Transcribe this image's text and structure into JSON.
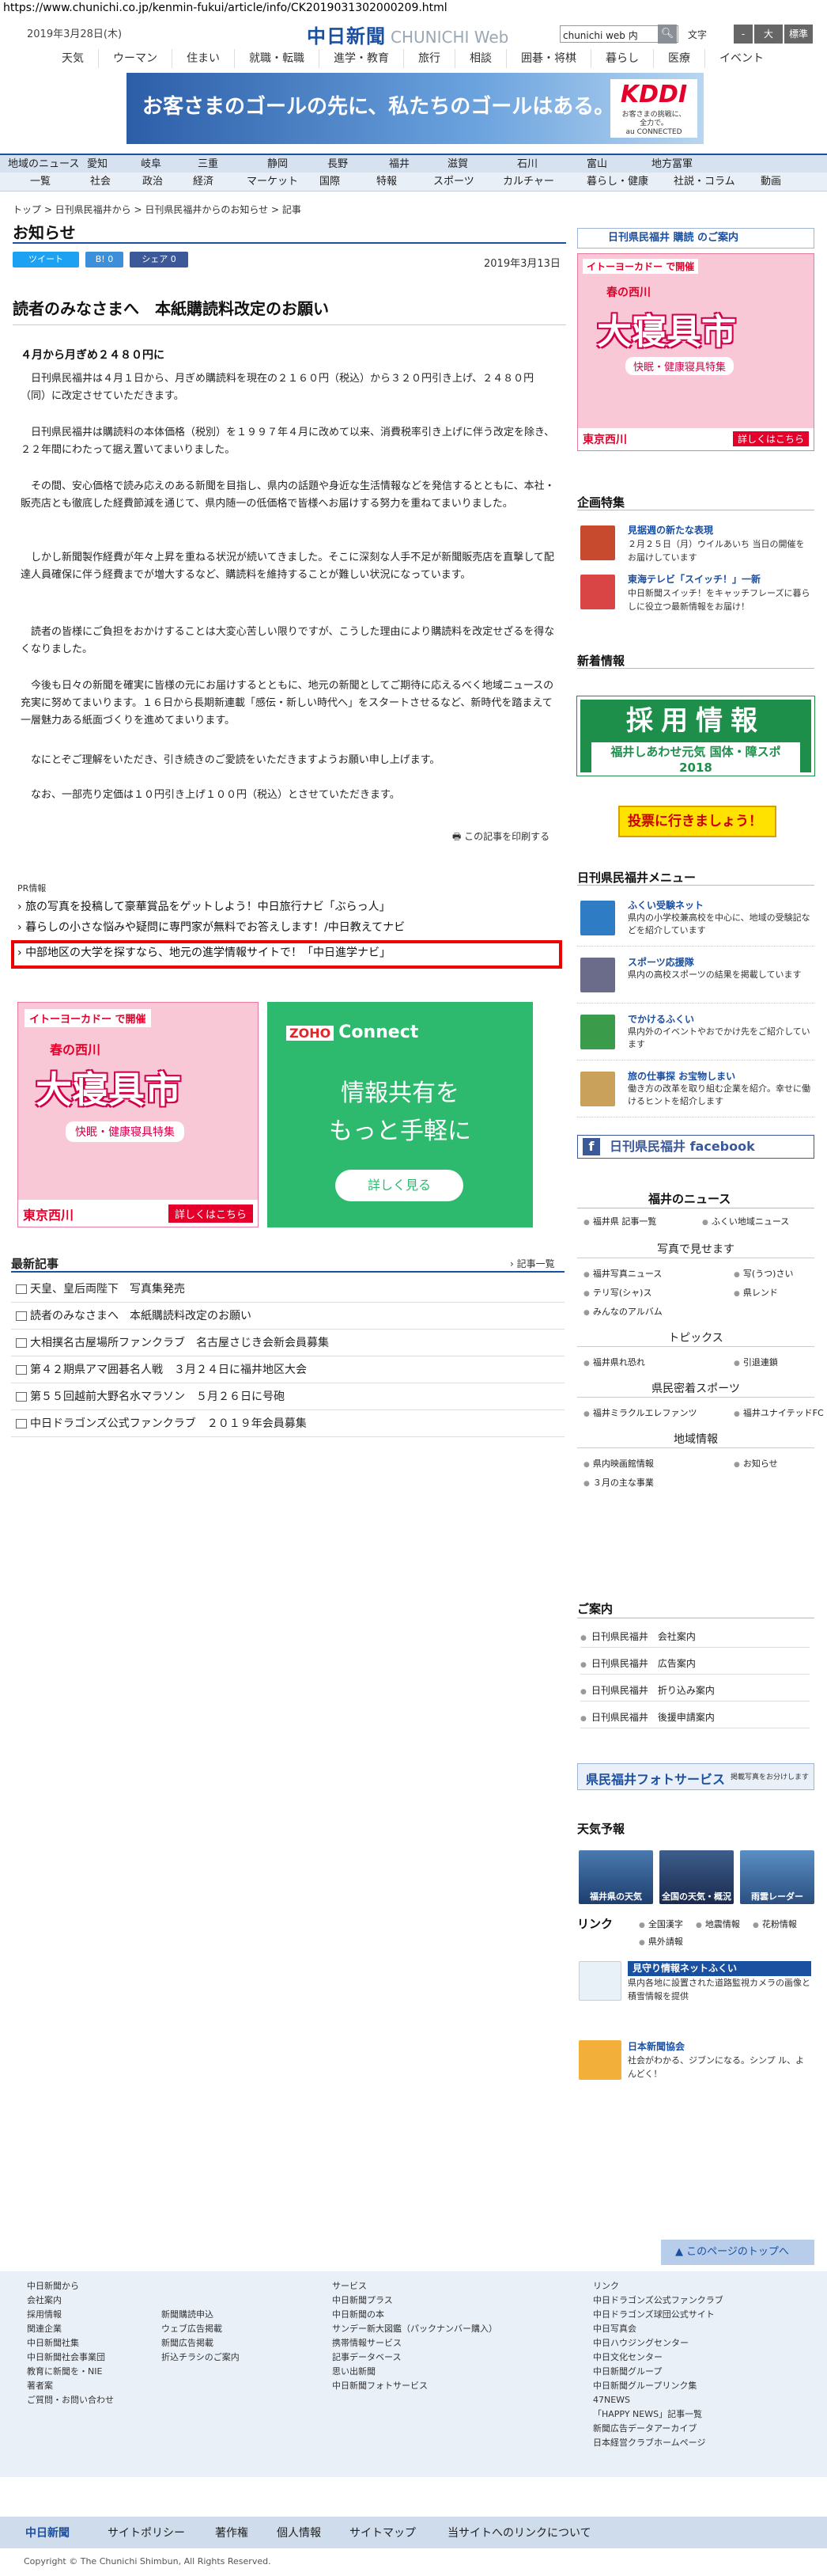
{
  "browser": {
    "url": "https://www.chunichi.co.jp/kenmin-fukui/article/info/CK2019031302000209.html"
  },
  "header": {
    "date": "2019年3月28日(木)",
    "logo_jp": "中日新聞",
    "logo_en": "CHUNICHI Web",
    "search_value": "chunichi web 内",
    "font_size_label": "文字",
    "font_minus": "-",
    "font_plus": "+",
    "font_large": "大",
    "font_normal": "標準",
    "nav": [
      "天気",
      "ウーマン",
      "住まい",
      "就職・転職",
      "進学・教育",
      "旅行",
      "相談",
      "囲碁・将棋",
      "暮らし",
      "医療",
      "イベント"
    ]
  },
  "banner": {
    "text": "お客さまのゴールの先に、私たちのゴールはある。",
    "brand": "KDDI",
    "brand_sub1": "お客さまの挑戦に、",
    "brand_sub2": "全力で。",
    "brand_sub3": "au CONNECTED"
  },
  "region_nav": [
    "地域のニュース",
    "愛知",
    "岐阜",
    "三重",
    "静岡",
    "長野",
    "福井",
    "滋賀",
    "石川",
    "富山",
    "地方冨軍"
  ],
  "category_nav": [
    "一覧",
    "社会",
    "政治",
    "経済",
    "マーケット",
    "国際",
    "特報",
    "スポーツ",
    "カルチャー",
    "暮らし・健康",
    "社説・コラム",
    "動画"
  ],
  "breadcrumb": "トップ > 日刊県民福井から > 日刊県民福井からのお知らせ > 記事",
  "page_title": "お知らせ",
  "share": {
    "tweet": "ツイート",
    "b": "B!",
    "b_count": "0",
    "share": "シェア",
    "share_count": "0"
  },
  "article": {
    "date": "2019年3月13日",
    "headline": "読者のみなさまへ　本紙購読料改定のお願い",
    "lead": "４月から月ぎめ２４８０円に",
    "paragraphs": [
      "　日刊県民福井は４月１日から、月ぎめ購読料を現在の２１６０円（税込）から３２０円引き上げ、２４８０円（同）に改定させていただきます。",
      "　日刊県民福井は購読料の本体価格（税別）を１９９７年４月に改めて以来、消費税率引き上げに伴う改定を除き、２２年間にわたって据え置いてまいりました。",
      "　その間、安心価格で読み応えのある新聞を目指し、県内の話題や身近な生活情報などを発信するとともに、本社・販売店とも徹底した経費節減を通じて、県内随一の低価格で皆様へお届けする努力を重ねてまいりました。",
      "　しかし新聞製作経費が年々上昇を重ねる状況が続いてきました。そこに深刻な人手不足が新聞販売店を直撃して配達人員確保に伴う経費までが増大するなど、購読料を維持することが難しい状況になっています。",
      "　読者の皆様にご負担をおかけすることは大変心苦しい限りですが、こうした理由により購読料を改定せざるを得なくなりました。",
      "　今後も日々の新聞を確実に皆様の元にお届けするとともに、地元の新聞としてご期待に応えるべく地域ニュースの充実に努めてまいります。１６日から長期新連載「感伝・新しい時代へ」をスタートさせるなど、新時代を踏まえて一層魅力ある紙面づくりを進めてまいります。",
      "　なにとぞご理解をいただき、引き続きのご愛読をいただきますようお願い申し上げます。",
      "　なお、一部売り定価は１０円引き上げ１００円（税込）とさせていただきます。"
    ],
    "print": "この記事を印刷する"
  },
  "pr": {
    "label": "PR情報",
    "items": [
      "旅の写真を投稿して豪華賞品をゲットしよう！中日旅行ナビ「ぶらっ人」",
      "暮らしの小さな悩みや疑問に専門家が無料でお答えします！/中日教えてナビ",
      "中部地区の大学を探すなら、地元の進学情報サイトで！「中日進学ナビ」"
    ]
  },
  "ad_ito": {
    "brand": "イトーヨーカドー で開催",
    "mid": "春の西川",
    "big": "大寝具市",
    "sub": "快眠・健康寝具特集",
    "store": "東京西川",
    "more": "詳しくはこちら"
  },
  "ad_zoho": {
    "brand": "ZOHO",
    "name": "Connect",
    "line1": "情報共有を",
    "line2": "もっと手軽に",
    "cta": "詳しく見る"
  },
  "latest": {
    "heading": "最新記事",
    "all": "記事一覧",
    "items": [
      "天皇、皇后両陛下　写真集発売",
      "読者のみなさまへ　本紙購読料改定のお願い",
      "大相撲名古屋場所ファンクラブ　名古屋さじき会新会員募集",
      "第４２期県アマ囲碁名人戦　３月２４日に福井地区大会",
      "第５５回越前大野名水マラソン　５月２６日に号砲",
      "中日ドラゴンズ公式ファンクラブ　２０１９年会員募集"
    ]
  },
  "right": {
    "kounyu": "日刊県民福井 購読 のご案内",
    "kikaku_heading": "企画特集",
    "kikaku": [
      {
        "title": "見据週の新たな表現",
        "desc": "２月２５日（月）ウイルあいち 当日の開催をお届けしています"
      },
      {
        "title": "東海テレビ「スイッチ！」一新",
        "desc": "中日新聞スイッチ！をキャッチフレーズに暮らしに役立つ最新情報をお届け！"
      }
    ],
    "shinsotsu_heading": "新着情報",
    "recruit_a": "採用情報",
    "recruit_b": "福井しあわせ元気 国体・障スポ 2018",
    "vote": "投票に行きましょう！",
    "menu_heading": "日刊県民福井メニュー",
    "menu": [
      {
        "title": "ふくい受験ネット",
        "desc": "県内の小学校兼高校を中心に、地域の受験記などを紹介しています"
      },
      {
        "title": "スポーツ応援隊",
        "desc": "県内の高校スポーツの結果を掲載しています"
      },
      {
        "title": "でかけるふくい",
        "desc": "県内外のイベントやおでかけ先をご紹介しています"
      },
      {
        "title": "旅の仕事探 お宝物しまい",
        "desc": "働き方の改革を取り組む企業を紹介。幸せに働けるヒントを紹介します"
      }
    ],
    "facebook": "日刊県民福井 facebook",
    "fukui_news": "福井のニュース",
    "news_links": [
      "福井県 記事一覧",
      "ふくい地域ニュース"
    ],
    "photo_head": "写真で見せます",
    "photo_links": [
      "福井写真ニュース",
      "写(うつ)さい",
      "テリ写(シャ)ス",
      "県レンド",
      "みんなのアルバム"
    ],
    "topics_head": "トピックス",
    "topics_links": [
      "福井県れ恐れ",
      "引退連鎖"
    ],
    "sports_head": "県民密着スポーツ",
    "sports_links": [
      "福井ミラクルエレファンツ",
      "福井ユナイテッドFC"
    ],
    "chiiki_head": "地域情報",
    "chiiki_links": [
      "県内映画館情報",
      "お知らせ",
      "３月の主な事業"
    ],
    "annai_heading": "ご案内",
    "annai": [
      "日刊県民福井　会社案内",
      "日刊県民福井　広告案内",
      "日刊県民福井　折り込み案内",
      "日刊県民福井　後援申請案内"
    ],
    "photoservice": "県民福井フォトサービス",
    "photoservice_sub": "掲載写真をお分けします",
    "weather_heading": "天気予報",
    "weather": [
      "福井県の天気",
      "全国の天気・概況",
      "雨雲レーダー"
    ],
    "link_heading": "リンク",
    "links_row": [
      "全国漢字",
      "地震情報",
      "花粉情報",
      "県外請報"
    ],
    "mimamori_title": "見守り情報ネットふくい",
    "mimamori_desc": "県内各地に設置された道路監視カメラの画像と積雪情報を提供",
    "newsbrain_title": "日本新聞協会",
    "newsbrain_desc": "社会がわかる、ジブンになる。シンプ ル、よんどく！"
  },
  "footer": {
    "totop": "このページのトップへ",
    "col1_head": "中日新聞から",
    "col1": [
      "会社案内",
      "採用情報",
      "関連企業",
      "中日新聞社集",
      "中日新聞社会事業団",
      "教育に新聞を・NIE",
      "著者案",
      "ご質問・お問い合わせ"
    ],
    "col2": [
      "新聞購読申込",
      "ウェブ広告掲載",
      "新聞広告掲載",
      "折込チラシのご案内"
    ],
    "col3_head": "サービス",
    "col3": [
      "中日新聞プラス",
      "中日新聞の本",
      "サンデー新大図鑑（パックナンバー購入）",
      "携帯情報サービス",
      "記事データベース",
      "思い出新聞",
      "中日新聞フォトサービス"
    ],
    "col4_head": "リンク",
    "col4": [
      "中日ドラゴンズ公式ファンクラブ",
      "中日ドラゴンズ球団公式サイト",
      "中日写真会",
      "中日ハウジングセンター",
      "中日文化センター",
      "中日新聞グループ",
      "中日新聞グループリンク集",
      "47NEWS",
      "「HAPPY NEWS」記事一覧",
      "新聞広告データアーカイブ",
      "日本経営クラブホームページ"
    ],
    "nav": [
      "中日新聞",
      "サイトポリシー",
      "著作権",
      "個人情報",
      "サイトマップ",
      "当サイトへのリンクについて"
    ],
    "copyright": "Copyright © The Chunichi Shimbun, All Rights Reserved."
  }
}
